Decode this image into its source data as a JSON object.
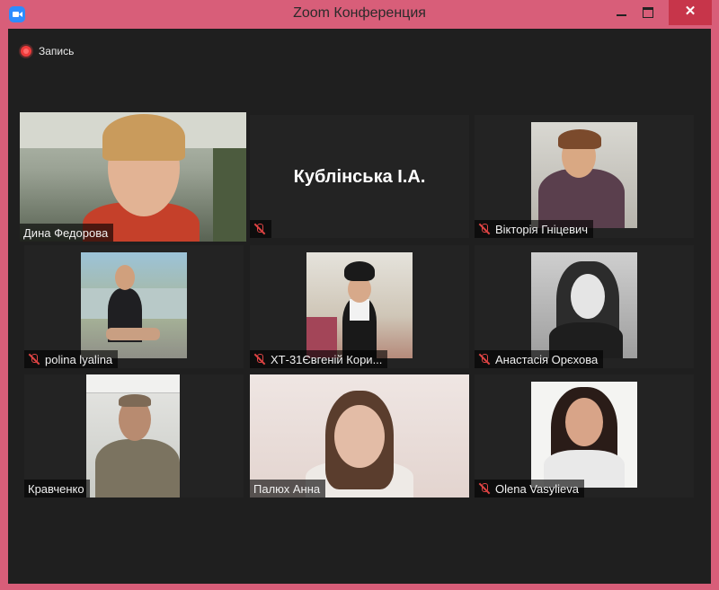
{
  "window": {
    "title": "Zoom Конференция",
    "close_glyph": "✕"
  },
  "toolbar": {
    "recording_label": "Запись"
  },
  "participants": [
    {
      "name": "Дина Федорова",
      "muted": false,
      "speaking": true
    },
    {
      "name": "Кублінська І.А.",
      "display_name": "Кублінська І.А.",
      "muted": true,
      "video": false
    },
    {
      "name": "Вікторія Гніцевич",
      "muted": true
    },
    {
      "name": "polina lyalina",
      "muted": true
    },
    {
      "name": "ХТ-31Євгеній Кори...",
      "muted": true
    },
    {
      "name": "Анастасія Орєхова",
      "muted": true
    },
    {
      "name": "Кравченко",
      "muted": false
    },
    {
      "name": "Палюх Анна",
      "muted": false
    },
    {
      "name": "Olena Vasylieva",
      "muted": true
    }
  ],
  "colors": {
    "window_frame": "#d85e79",
    "meeting_background": "#1f1f1f",
    "active_speaker_outline": "#c9ec5e",
    "muted_icon": "#e04444"
  },
  "icons": {
    "app": "zoom-logo-icon",
    "recording": "recording-dot-icon",
    "muted": "mic-muted-icon"
  }
}
